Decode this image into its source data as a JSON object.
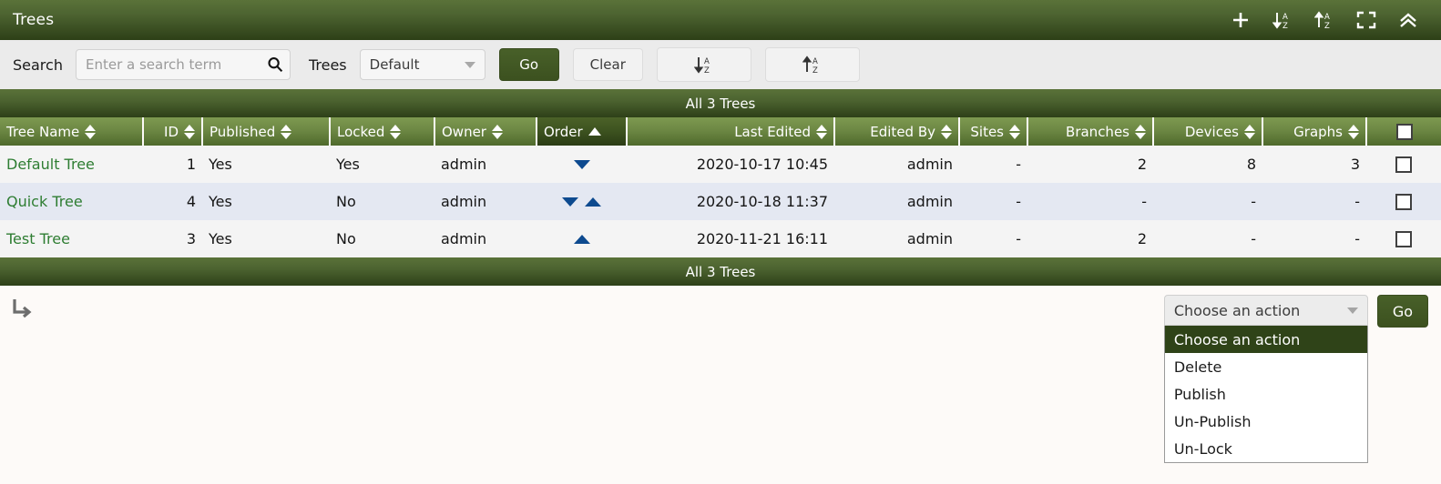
{
  "window": {
    "title": "Trees",
    "icons": [
      {
        "name": "add-icon",
        "glyph": "plus"
      },
      {
        "name": "sort-descending-icon",
        "glyph": "sort-az-down"
      },
      {
        "name": "sort-ascending-icon",
        "glyph": "sort-az-up"
      },
      {
        "name": "expand-icon",
        "glyph": "fullscreen"
      },
      {
        "name": "collapse-icon",
        "glyph": "double-chevron-up"
      }
    ]
  },
  "toolbar": {
    "search_label": "Search",
    "search_placeholder": "Enter a search term",
    "search_value": "",
    "search_icon": "search-icon",
    "trees_label": "Trees",
    "trees_selected": "Default",
    "go_label": "Go",
    "clear_label": "Clear",
    "sort_desc_icon": "sort-az-down-icon",
    "sort_asc_icon": "sort-az-up-icon"
  },
  "table": {
    "header_bar": "All 3 Trees",
    "footer_bar": "All 3 Trees",
    "columns": [
      {
        "label": "Tree Name",
        "align": "left",
        "sort": "both",
        "active": false
      },
      {
        "label": "ID",
        "align": "right",
        "sort": "both",
        "active": false
      },
      {
        "label": "Published",
        "align": "left",
        "sort": "both",
        "active": false
      },
      {
        "label": "Locked",
        "align": "left",
        "sort": "both",
        "active": false
      },
      {
        "label": "Owner",
        "align": "left",
        "sort": "both",
        "active": false
      },
      {
        "label": "Order",
        "align": "left",
        "sort": "up",
        "active": true
      },
      {
        "label": "Last Edited",
        "align": "right",
        "sort": "both",
        "active": false
      },
      {
        "label": "Edited By",
        "align": "right",
        "sort": "both",
        "active": false
      },
      {
        "label": "Sites",
        "align": "right",
        "sort": "both",
        "active": false
      },
      {
        "label": "Branches",
        "align": "right",
        "sort": "both",
        "active": false
      },
      {
        "label": "Devices",
        "align": "right",
        "sort": "both",
        "active": false
      },
      {
        "label": "Graphs",
        "align": "right",
        "sort": "both",
        "active": false
      },
      {
        "label": "",
        "align": "center",
        "sort": "none",
        "active": false
      }
    ],
    "rows": [
      {
        "tree_name": "Default Tree",
        "id": "1",
        "published": "Yes",
        "locked": "Yes",
        "owner": "admin",
        "order_down": true,
        "order_up": false,
        "last_edited": "2020-10-17 10:45",
        "edited_by": "admin",
        "sites": "-",
        "branches": "2",
        "devices": "8",
        "graphs": "3",
        "checked": false
      },
      {
        "tree_name": "Quick Tree",
        "id": "4",
        "published": "Yes",
        "locked": "No",
        "owner": "admin",
        "order_down": true,
        "order_up": true,
        "last_edited": "2020-10-18 11:37",
        "edited_by": "admin",
        "sites": "-",
        "branches": "-",
        "devices": "-",
        "graphs": "-",
        "checked": false
      },
      {
        "tree_name": "Test Tree",
        "id": "3",
        "published": "Yes",
        "locked": "No",
        "owner": "admin",
        "order_down": false,
        "order_up": true,
        "last_edited": "2020-11-21 16:11",
        "edited_by": "admin",
        "sites": "-",
        "branches": "2",
        "devices": "-",
        "graphs": "-",
        "checked": false
      }
    ]
  },
  "footer": {
    "sub_icon": "sub-action-arrow-icon",
    "action_selected": "Choose an action",
    "action_options": [
      "Choose an action",
      "Delete",
      "Publish",
      "Un-Publish",
      "Un-Lock"
    ],
    "action_highlighted_index": 0,
    "go_label": "Go"
  },
  "colors": {
    "brand_green_light": "#5a7239",
    "brand_green_dark": "#2d3f17",
    "header_green": "#6d8844",
    "active_header_green": "#3e5420",
    "link_green": "#2e7d32",
    "row_alt": "#e4e8f2",
    "row_base": "#f4f4f4",
    "order_arrow_blue": "#0d4a8f",
    "page_background": "#fdfaf8"
  }
}
